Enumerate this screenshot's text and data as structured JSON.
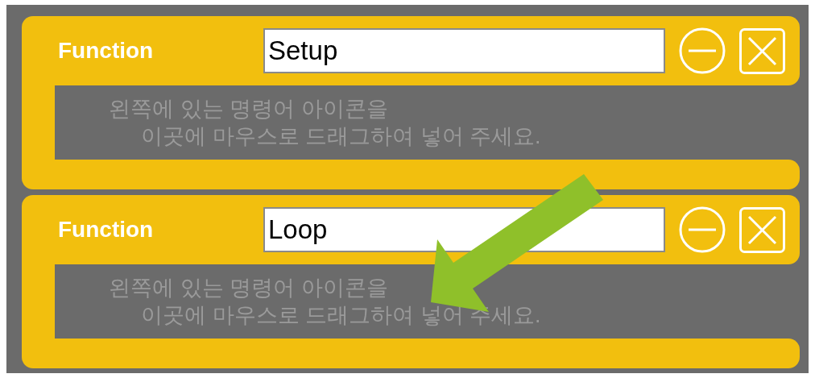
{
  "functions": [
    {
      "label": "Function",
      "name": "Setup",
      "hint_lines": [
        "왼쪽에 있는 명령어 아이콘을",
        "이곳에 마우스로 드래그하여 넣어 주세요."
      ]
    },
    {
      "label": "Function",
      "name": "Loop",
      "hint_lines": [
        "왼쪽에 있는 명령어 아이콘을",
        "이곳에 마우스로 드래그하여 넣어 주세요."
      ]
    }
  ]
}
